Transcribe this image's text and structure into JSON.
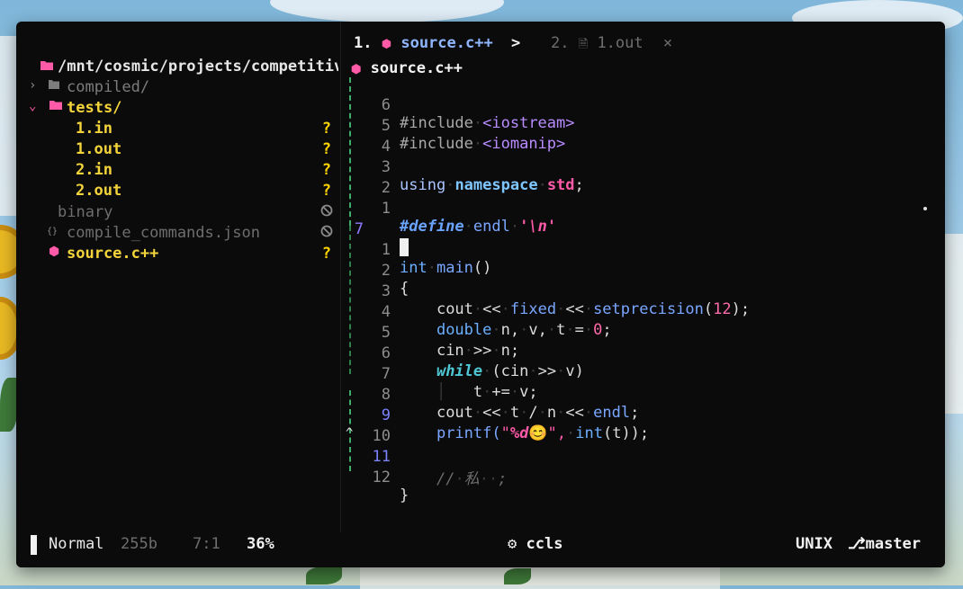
{
  "colors": {
    "accent_pink": "#ff5aa8",
    "accent_yellow": "#f4d43b",
    "accent_blue": "#8fb6ff",
    "background": "#0b0b0c"
  },
  "sidebar": {
    "root_path": "/mnt/cosmic/projects/competitiv",
    "items": [
      {
        "label": "compiled/",
        "icon": "folder-icon",
        "status": ""
      },
      {
        "label": "tests/",
        "icon": "folder-open-icon",
        "status": ""
      },
      {
        "label": "1.in",
        "status": "?"
      },
      {
        "label": "1.out",
        "status": "?"
      },
      {
        "label": "2.in",
        "status": "?"
      },
      {
        "label": "2.out",
        "status": "?"
      },
      {
        "label": "binary",
        "status": "ignored"
      },
      {
        "label": "compile_commands.json",
        "icon": "json-icon",
        "status": "ignored"
      },
      {
        "label": "source.c++",
        "icon": "cpp-icon",
        "status": "?"
      }
    ]
  },
  "tabs": [
    {
      "number": "1.",
      "label": "source.c++",
      "active": true,
      "separator": ">"
    },
    {
      "number": "2.",
      "label": "1.out",
      "active": false,
      "close": "×"
    }
  ],
  "winbar": {
    "filename": "source.c++"
  },
  "editor": {
    "lines": [
      {
        "ln": "6"
      },
      {
        "ln": "5"
      },
      {
        "ln": "4"
      },
      {
        "ln": "3"
      },
      {
        "ln": "2"
      },
      {
        "ln": "1"
      },
      {
        "ln": "7"
      },
      {
        "ln": "1"
      },
      {
        "ln": "2"
      },
      {
        "ln": "3"
      },
      {
        "ln": "4"
      },
      {
        "ln": "5"
      },
      {
        "ln": "6"
      },
      {
        "ln": "7"
      },
      {
        "ln": "8"
      },
      {
        "ln": "9"
      },
      {
        "ln": "10"
      },
      {
        "ln": "11"
      },
      {
        "ln": "12"
      }
    ],
    "code": {
      "include1_kw": "#include",
      "include1_hdr": "<iostream>",
      "include2_kw": "#include",
      "include2_hdr": "<iomanip>",
      "using": "using",
      "namespace": "namespace",
      "std": "std",
      "semicolon": ";",
      "define": "#define",
      "endl_macro": "endl",
      "newline_char": "'\\n'",
      "int": "int",
      "main": "main",
      "parens": "()",
      "lbrace": "{",
      "rbrace": "}",
      "l3": [
        "cout",
        "<<",
        "fixed",
        "<<",
        "setprecision",
        "(",
        "12",
        ");"
      ],
      "l4": [
        "double",
        "n,",
        "v,",
        "t",
        "=",
        "0",
        ";"
      ],
      "l5": [
        "cin",
        ">>",
        "n;"
      ],
      "l6": [
        "while",
        "(cin",
        ">>",
        "v)"
      ],
      "l7": [
        "t",
        "+=",
        "v;"
      ],
      "l8": [
        "cout",
        "<<",
        "t",
        "/",
        "n",
        "<<",
        "endl",
        ";"
      ],
      "l9": [
        "printf(",
        "\"",
        "%d",
        "😊",
        "\",",
        "int",
        "(t));"
      ],
      "l11": [
        "//",
        "私",
        ";"
      ]
    }
  },
  "statusline": {
    "mode": "Normal",
    "size": "255b",
    "position": "7:1",
    "percent": "36%",
    "lsp": "ccls",
    "format": "UNIX",
    "branch": "master"
  }
}
